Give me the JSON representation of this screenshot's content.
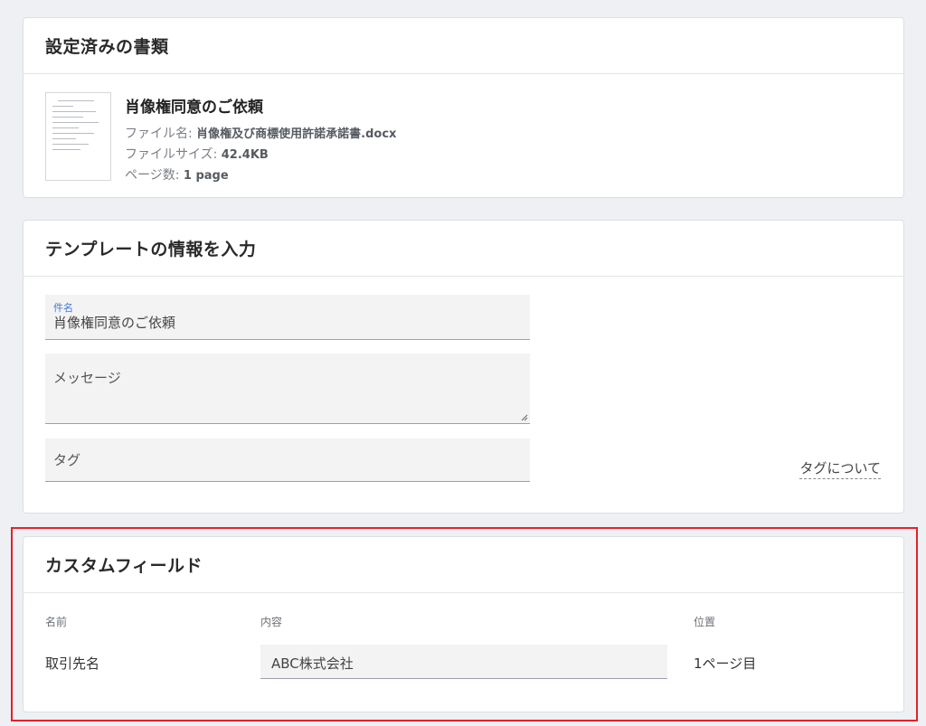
{
  "documents_card": {
    "title": "設定済みの書類",
    "document": {
      "title": "肖像権同意のご依頼",
      "file_name_label": "ファイル名: ",
      "file_name": "肖像権及び商標使用許諾承諾書.docx",
      "file_size_label": "ファイルサイズ: ",
      "file_size": "42.4KB",
      "pages_label": "ページ数: ",
      "pages": "1 page"
    }
  },
  "template_card": {
    "title": "テンプレートの情報を入力",
    "subject_label": "件名",
    "subject_value": "肖像権同意のご依頼",
    "message_placeholder": "メッセージ",
    "tag_placeholder": "タグ",
    "tag_help_link": "タグについて"
  },
  "custom_fields_card": {
    "title": "カスタムフィールド",
    "columns": {
      "name": "名前",
      "content": "内容",
      "position": "位置"
    },
    "rows": [
      {
        "name": "取引先名",
        "content": "ABC株式会社",
        "position": "1ページ目"
      }
    ]
  },
  "colors": {
    "highlight": "#e3222c",
    "accent": "#3f76d8"
  }
}
